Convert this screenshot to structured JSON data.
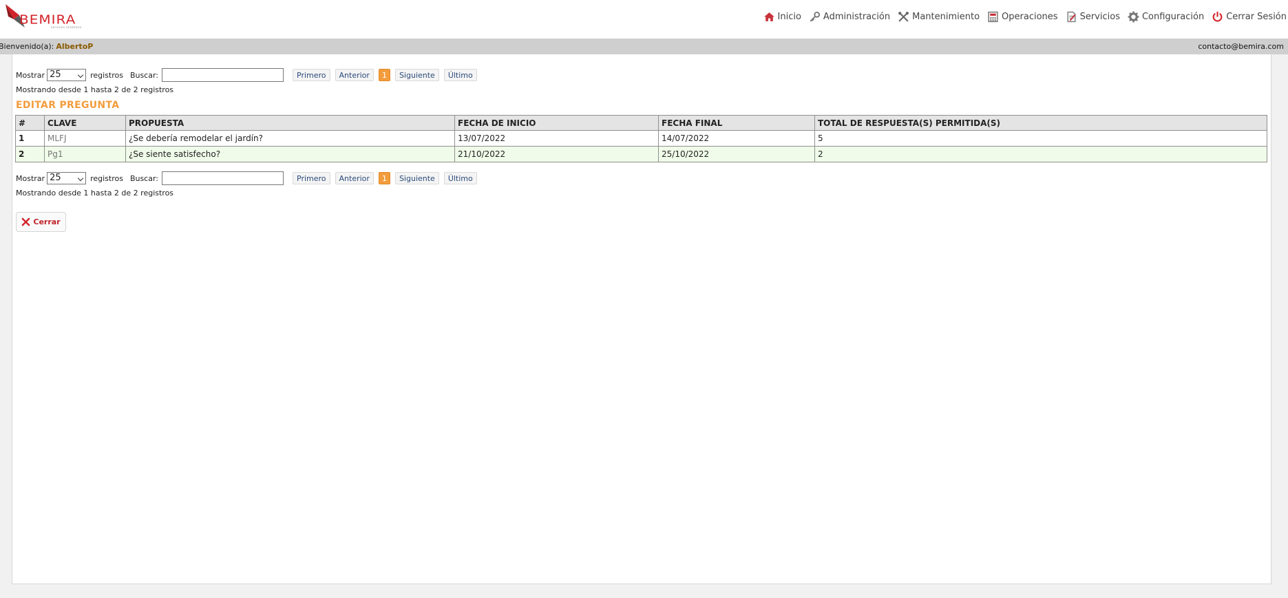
{
  "brand": {
    "name": "BEMIRA",
    "tagline": "services solutions",
    "accent": "#d2232a"
  },
  "nav": [
    {
      "label": "Inicio",
      "icon": "home-icon"
    },
    {
      "label": "Administración",
      "icon": "key-icon"
    },
    {
      "label": "Mantenimiento",
      "icon": "tools-icon"
    },
    {
      "label": "Operaciones",
      "icon": "calculator-icon"
    },
    {
      "label": "Servicios",
      "icon": "document-icon"
    },
    {
      "label": "Configuración",
      "icon": "gear-icon"
    },
    {
      "label": "Cerrar Sesión",
      "icon": "power-icon"
    }
  ],
  "welcome": {
    "prefix": "Bienvenido(a):",
    "user": "AlbertoP",
    "email": "contacto@bemira.com"
  },
  "controls": {
    "show_label": "Mostrar",
    "show_value": "25",
    "records_label": "registros",
    "search_label": "Buscar:",
    "search_value": "",
    "pager": {
      "first": "Primero",
      "prev": "Anterior",
      "current": "1",
      "next": "Siguiente",
      "last": "Último"
    },
    "info": "Mostrando desde 1 hasta 2 de 2 registros"
  },
  "section_title": "EDITAR PREGUNTA",
  "table": {
    "headers": [
      "#",
      "CLAVE",
      "PROPUESTA",
      "FECHA DE INICIO",
      "FECHA FINAL",
      "TOTAL DE RESPUESTA(S) PERMITIDA(S)"
    ],
    "rows": [
      [
        "1",
        "MLFJ",
        "¿Se debería remodelar el jardín?",
        "13/07/2022",
        "14/07/2022",
        "5"
      ],
      [
        "2",
        "Pg1",
        "¿Se siente satisfecho?",
        "21/10/2022",
        "25/10/2022",
        "2"
      ]
    ]
  },
  "close_button": "Cerrar",
  "colors": {
    "accent": "#f39c3c",
    "row_alt": "#f0fbe9",
    "welcome_bg": "#cfcfcf"
  }
}
